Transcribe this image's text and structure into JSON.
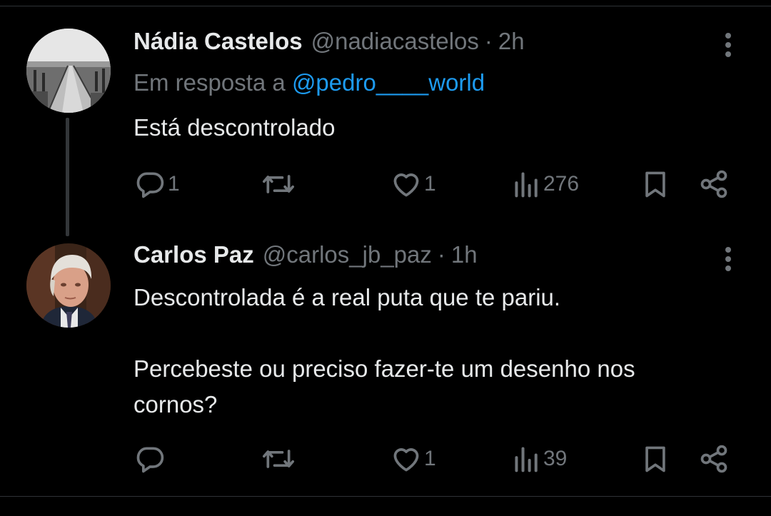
{
  "tweets": [
    {
      "display_name": "Nádia Castelos",
      "handle": "@nadiacastelos",
      "separator": "·",
      "time": "2h",
      "reply_prefix": "Em resposta a",
      "reply_mention": "@pedro____world",
      "text": "Está descontrolado",
      "actions": {
        "replies": "1",
        "reposts": "",
        "likes": "1",
        "views": "276"
      },
      "avatar_icon": "boardwalk-photo-avatar"
    },
    {
      "display_name": "Carlos Paz",
      "handle": "@carlos_jb_paz",
      "separator": "·",
      "time": "1h",
      "text": "Descontrolada é a real puta que te pariu.\n\nPercebeste ou preciso fazer-te um desenho nos\ncornos?",
      "actions": {
        "replies": "",
        "reposts": "",
        "likes": "1",
        "views": "39"
      },
      "avatar_icon": "man-portrait-avatar"
    }
  ],
  "colors": {
    "background": "#000000",
    "primary_text": "#e7e9ea",
    "secondary_text": "#71767b",
    "mention": "#1d9bf0",
    "divider": "#2f3336"
  },
  "icons": [
    "reply-icon",
    "repost-icon",
    "like-icon",
    "views-icon",
    "bookmark-icon",
    "share-icon",
    "more-icon"
  ]
}
